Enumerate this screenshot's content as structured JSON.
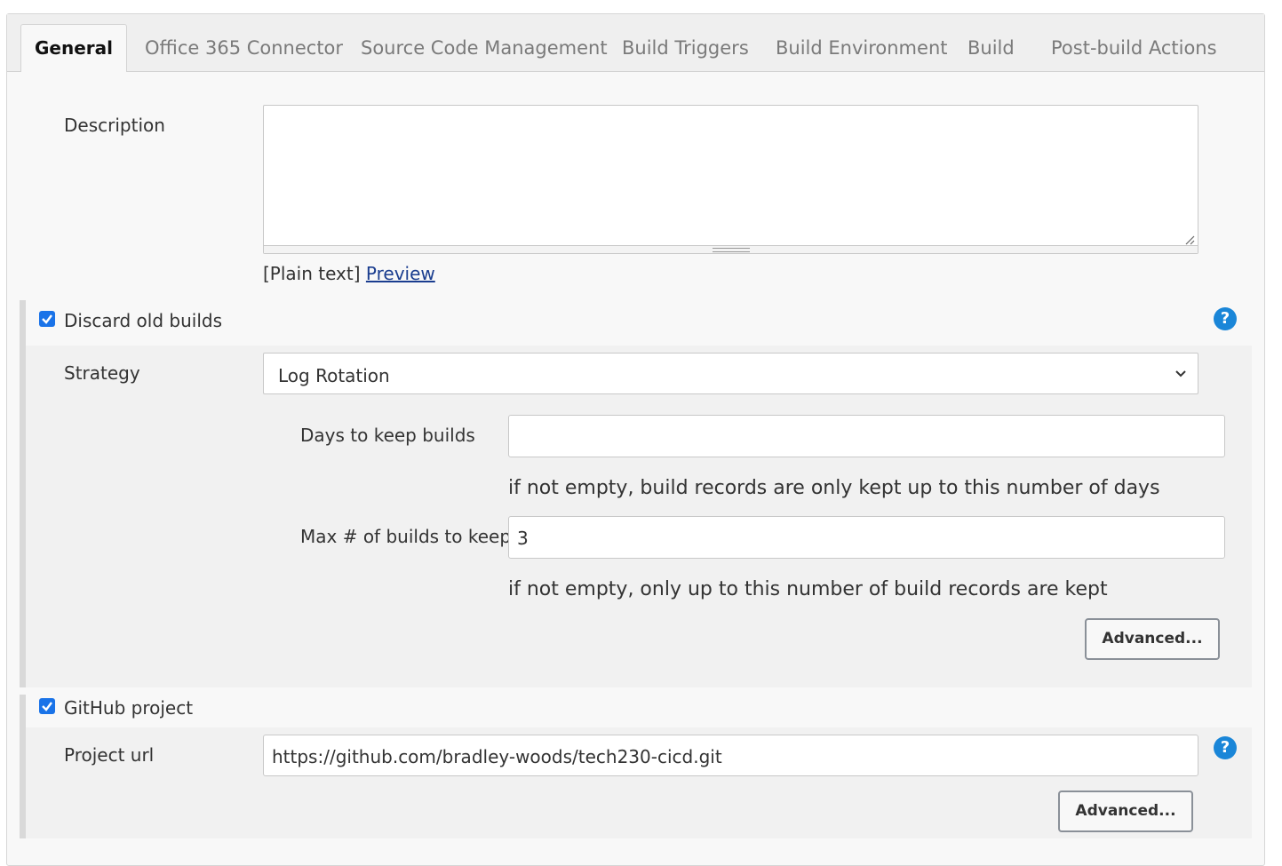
{
  "tabs": [
    {
      "label": "General",
      "active": true
    },
    {
      "label": "Office 365 Connector"
    },
    {
      "label": "Source Code Management"
    },
    {
      "label": "Build Triggers"
    },
    {
      "label": "Build Environment"
    },
    {
      "label": "Build"
    },
    {
      "label": "Post-build Actions"
    }
  ],
  "description": {
    "label": "Description",
    "value": "",
    "format_label": "[Plain text]",
    "preview_link": "Preview"
  },
  "discard_old_builds": {
    "label": "Discard old builds",
    "checked": true,
    "help_icon": "?",
    "strategy_label": "Strategy",
    "strategy_value": "Log Rotation",
    "days_label": "Days to keep builds",
    "days_value": "",
    "days_hint": "if not empty, build records are only kept up to this number of days",
    "max_label": "Max # of builds to keep",
    "max_value": "3",
    "max_hint": "if not empty, only up to this number of build records are kept",
    "advanced_label": "Advanced..."
  },
  "github_project": {
    "label": "GitHub project",
    "checked": true,
    "help_icon": "?",
    "url_label": "Project url",
    "url_value": "https://github.com/bradley-woods/tech230-cicd.git",
    "advanced_label": "Advanced..."
  },
  "colors": {
    "checkbox": "#1a73e8",
    "help_icon": "#1a86d8",
    "link": "#1a3d8f"
  }
}
